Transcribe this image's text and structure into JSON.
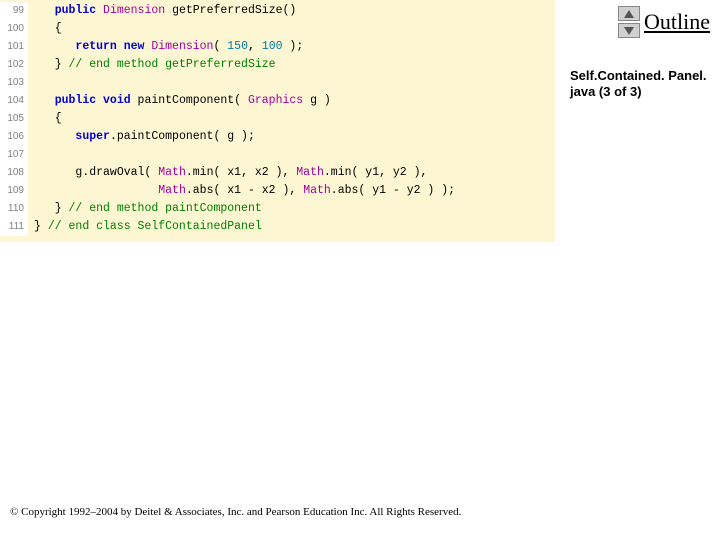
{
  "outline_label": "Outline",
  "file_info": "Self.Contained. Panel. java (3 of 3)",
  "copyright": "© Copyright 1992–2004 by Deitel & Associates, Inc. and Pearson Education Inc. All Rights Reserved.",
  "lines": [
    {
      "n": "99",
      "indent": 1,
      "tokens": [
        [
          "kw",
          "public"
        ],
        [
          "sp",
          " "
        ],
        [
          "cls",
          "Dimension"
        ],
        [
          "pl",
          " getPreferredSize()"
        ]
      ]
    },
    {
      "n": "100",
      "indent": 1,
      "tokens": [
        [
          "pl",
          "{"
        ]
      ]
    },
    {
      "n": "101",
      "indent": 2,
      "tokens": [
        [
          "kw",
          "return new"
        ],
        [
          "sp",
          " "
        ],
        [
          "cls",
          "Dimension"
        ],
        [
          "pl",
          "( "
        ],
        [
          "num",
          "150"
        ],
        [
          "pl",
          ", "
        ],
        [
          "num",
          "100"
        ],
        [
          "pl",
          " );"
        ]
      ]
    },
    {
      "n": "102",
      "indent": 1,
      "tokens": [
        [
          "pl",
          "} "
        ],
        [
          "cmt",
          "// end method getPreferredSize"
        ]
      ]
    },
    {
      "n": "103",
      "indent": 0,
      "tokens": [
        [
          "pl",
          ""
        ]
      ]
    },
    {
      "n": "104",
      "indent": 1,
      "tokens": [
        [
          "kw",
          "public void"
        ],
        [
          "pl",
          " paintComponent( "
        ],
        [
          "cls",
          "Graphics"
        ],
        [
          "pl",
          " g )"
        ]
      ]
    },
    {
      "n": "105",
      "indent": 1,
      "tokens": [
        [
          "pl",
          "{"
        ]
      ]
    },
    {
      "n": "106",
      "indent": 2,
      "tokens": [
        [
          "kw",
          "super"
        ],
        [
          "pl",
          ".paintComponent( g );"
        ]
      ]
    },
    {
      "n": "107",
      "indent": 0,
      "tokens": [
        [
          "pl",
          ""
        ]
      ]
    },
    {
      "n": "108",
      "indent": 2,
      "tokens": [
        [
          "pl",
          "g.drawOval( "
        ],
        [
          "cls",
          "Math"
        ],
        [
          "pl",
          ".min( x1, x2 ), "
        ],
        [
          "cls",
          "Math"
        ],
        [
          "pl",
          ".min( y1, y2 ),"
        ]
      ]
    },
    {
      "n": "109",
      "indent": 2,
      "tokens": [
        [
          "pl",
          "            "
        ],
        [
          "cls",
          "Math"
        ],
        [
          "pl",
          ".abs( x1 - x2 ), "
        ],
        [
          "cls",
          "Math"
        ],
        [
          "pl",
          ".abs( y1 - y2 ) );"
        ]
      ]
    },
    {
      "n": "110",
      "indent": 1,
      "tokens": [
        [
          "pl",
          "} "
        ],
        [
          "cmt",
          "// end method paintComponent"
        ]
      ]
    },
    {
      "n": "111",
      "indent": 0,
      "tokens": [
        [
          "pl",
          "} "
        ],
        [
          "cmt",
          "// end class SelfContainedPanel"
        ]
      ]
    }
  ]
}
